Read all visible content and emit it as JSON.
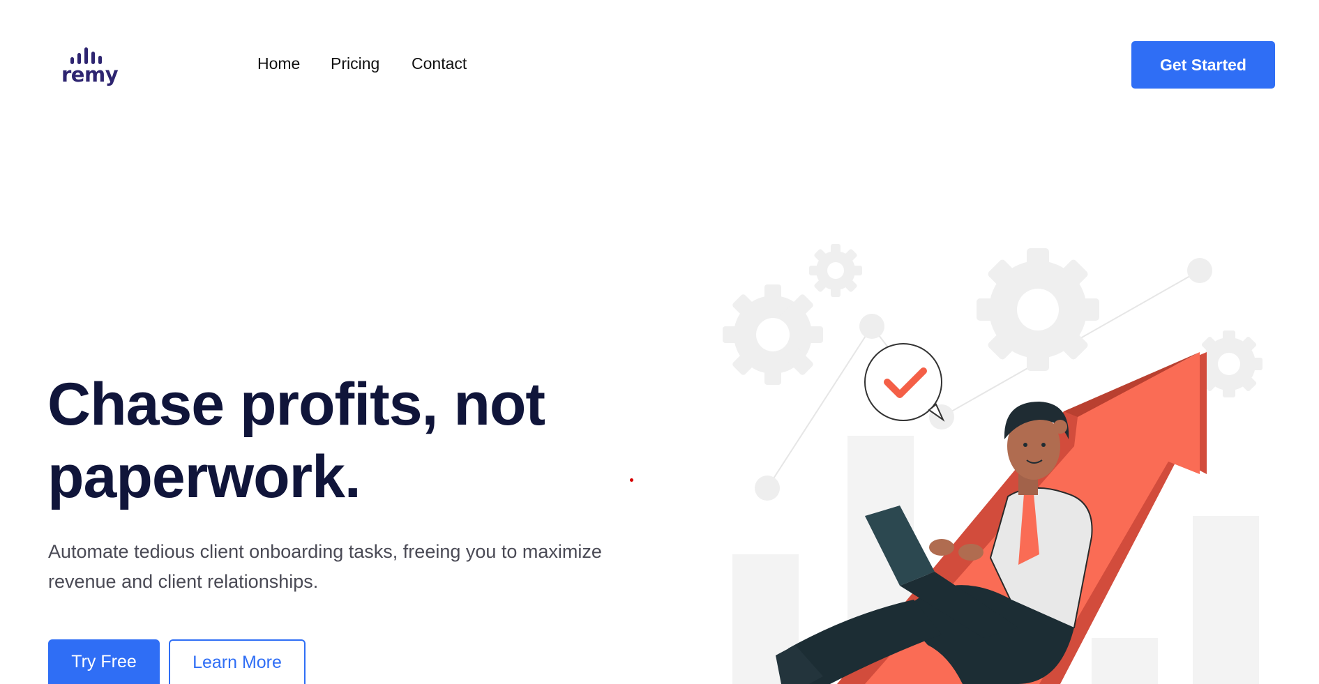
{
  "brand": {
    "name": "remy",
    "color": "#2d2470"
  },
  "nav": {
    "home": "Home",
    "pricing": "Pricing",
    "contact": "Contact"
  },
  "header": {
    "cta_label": "Get Started"
  },
  "hero": {
    "headline_line1": "Chase profits, not",
    "headline_line2": "paperwork.",
    "subtext_line1": "Automate tedious client onboarding tasks, freeing you to maximize",
    "subtext_line2": "revenue and client relationships.",
    "primary_label": "Try Free",
    "secondary_label": "Learn More"
  },
  "illustration": {
    "subject": "person-with-laptop-on-growth-arrow",
    "icons": [
      "gear-icon",
      "checkmark-icon",
      "arrow-up-icon"
    ]
  },
  "colors": {
    "accent": "#2f6ef5",
    "heading": "#10153a",
    "arrow": "#fa6c55",
    "arrow_shadow": "#d24c3c",
    "gear": "#efefef"
  }
}
